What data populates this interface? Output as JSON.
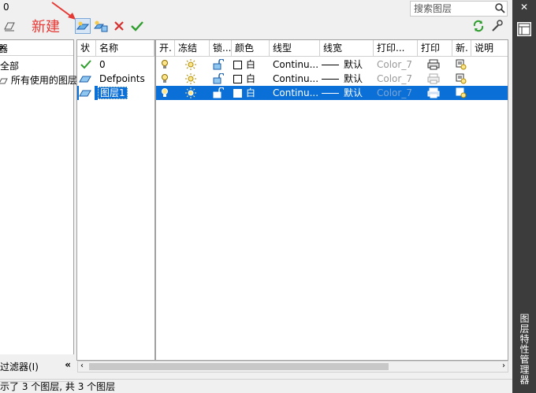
{
  "toolbar": {
    "current_layer": "0",
    "annotation_new": "新建",
    "search_placeholder": "搜索图层",
    "buttons": {
      "new_layer": "new-layer-icon",
      "new_layer_vp_frozen": "new-layer-vp-icon",
      "delete_layer": "delete-icon",
      "set_current": "checkmark-icon",
      "refresh": "refresh-icon",
      "settings": "wrench-icon"
    }
  },
  "filters": {
    "items": [
      "全部",
      "所有使用的图层"
    ],
    "footer_label": "过滤器(I)"
  },
  "columns": [
    "状",
    "名称",
    "开.",
    "冻结",
    "锁...",
    "颜色",
    "线型",
    "线宽",
    "打印...",
    "打印",
    "新.",
    "说明"
  ],
  "layers": [
    {
      "status": "current",
      "name": "0",
      "color": "白",
      "linetype": "Continu...",
      "lineweight": "默认",
      "plot_style": "Color_7"
    },
    {
      "status": "layer",
      "name": "Defpoints",
      "color": "白",
      "linetype": "Continu...",
      "lineweight": "默认",
      "plot_style": "Color_7"
    },
    {
      "status": "layer",
      "name": "图层1",
      "color": "白",
      "linetype": "Continu...",
      "lineweight": "默认",
      "plot_style": "Color_7"
    }
  ],
  "status_bar": "示了 3 个图层, 共 3 个图层",
  "sidebar": {
    "title": "图层特性管理器"
  },
  "colors": {
    "selection": "#0a6fd6",
    "annotation": "#e53935",
    "check_green": "#2e9d2e",
    "delete_red": "#d32f2f"
  }
}
